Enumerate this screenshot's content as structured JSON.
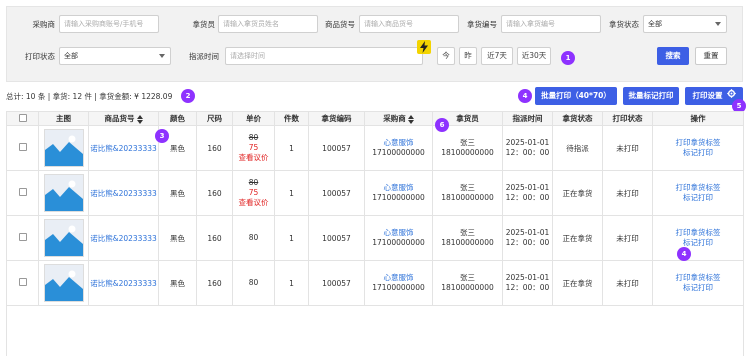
{
  "filters": {
    "buyer": {
      "label": "采购商",
      "placeholder": "请输入采购商账号/手机号"
    },
    "picker": {
      "label": "拿货员",
      "placeholder": "请输入拿货员姓名"
    },
    "goods_no": {
      "label": "商品货号",
      "placeholder": "请输入商品货号"
    },
    "pick_no": {
      "label": "拿货编号",
      "placeholder": "请输入拿货编号"
    },
    "pick_status": {
      "label": "拿货状态",
      "value": "全部"
    },
    "print_status": {
      "label": "打印状态",
      "value": "全部"
    },
    "assign_time": {
      "label": "指派时间",
      "placeholder": "请选择时间"
    },
    "quick_dates": [
      "今",
      "昨",
      "近7天",
      "近30天"
    ],
    "search_label": "搜索",
    "reset_label": "重置"
  },
  "summary": "总计: 10 条 | 拿货: 12 件 | 拿货金额: ¥ 1228.09",
  "actions": {
    "batch_print": "批量打印（40*70）",
    "batch_mark": "批量标记打印",
    "print_settings": "打印设置"
  },
  "markers": [
    "1",
    "2",
    "3",
    "4",
    "4",
    "5",
    "6"
  ],
  "colors": {
    "accent": "#3d5fe5",
    "marker": "#8e32ff",
    "link": "#2d72d9",
    "price_red": "#e02020"
  },
  "table": {
    "headers": [
      "主图",
      "商品货号",
      "颜色",
      "尺码",
      "单价",
      "件数",
      "拿货编码",
      "采购商",
      "拿货员",
      "指派时间",
      "拿货状态",
      "打印状态",
      "操作"
    ],
    "rows": [
      {
        "goods_no": "诺比熊&20233333",
        "color": "黑色",
        "size": "160",
        "price_old": "80",
        "price_new": "75",
        "price_link": "查看议价",
        "qty": "1",
        "code": "100057",
        "buyer_name": "心意服饰",
        "buyer_phone": "17100000000",
        "picker_name": "张三",
        "picker_phone": "18100000000",
        "date": "2025-01-01",
        "time": "12：00：00",
        "status": "待指派",
        "print": "未打印",
        "op1": "打印拿货标签",
        "op2": "标记打印"
      },
      {
        "goods_no": "诺比熊&20233333",
        "color": "黑色",
        "size": "160",
        "price_old": "80",
        "price_new": "75",
        "price_link": "查看议价",
        "qty": "1",
        "code": "100057",
        "buyer_name": "心意服饰",
        "buyer_phone": "17100000000",
        "picker_name": "张三",
        "picker_phone": "18100000000",
        "date": "2025-01-01",
        "time": "12：00：00",
        "status": "正在拿货",
        "print": "未打印",
        "op1": "打印拿货标签",
        "op2": "标记打印"
      },
      {
        "goods_no": "诺比熊&20233333",
        "color": "黑色",
        "size": "160",
        "price": "80",
        "qty": "1",
        "code": "100057",
        "buyer_name": "心意服饰",
        "buyer_phone": "17100000000",
        "picker_name": "张三",
        "picker_phone": "18100000000",
        "date": "2025-01-01",
        "time": "12：00：00",
        "status": "正在拿货",
        "print": "未打印",
        "op1": "打印拿货标签",
        "op2": "标记打印"
      },
      {
        "goods_no": "诺比熊&20233333",
        "color": "黑色",
        "size": "160",
        "price": "80",
        "qty": "1",
        "code": "100057",
        "buyer_name": "心意服饰",
        "buyer_phone": "17100000000",
        "picker_name": "张三",
        "picker_phone": "18100000000",
        "date": "2025-01-01",
        "time": "12：00：00",
        "status": "正在拿货",
        "print": "未打印",
        "op1": "打印拿货标签",
        "op2": "标记打印"
      }
    ]
  }
}
